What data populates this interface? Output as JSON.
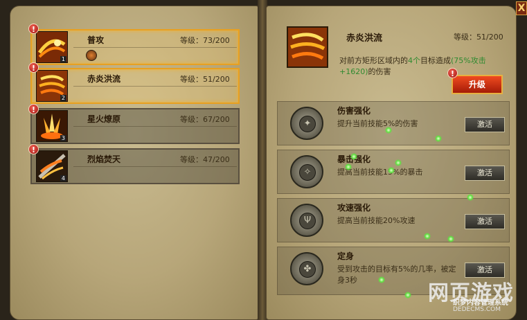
{
  "window": {
    "close_label": "X"
  },
  "skills": [
    {
      "name": "普攻",
      "level": "等级：73/200",
      "slot": "1"
    },
    {
      "name": "赤炎洪流",
      "level": "等级：51/200",
      "slot": "2"
    },
    {
      "name": "星火燎原",
      "level": "等级：67/200",
      "slot": "3"
    },
    {
      "name": "烈焰焚天",
      "level": "等级：47/200",
      "slot": "4"
    }
  ],
  "alert_mark": "!",
  "detail": {
    "title": "赤炎洪流",
    "level": "等级：51/200",
    "desc_a": "对前方矩形区域内的",
    "desc_b": "4个",
    "desc_c": "目标造成",
    "desc_d": "(75%攻击+1620)",
    "desc_e": "的伤害",
    "upgrade_label": "升级"
  },
  "enhancements": [
    {
      "name": "伤害强化",
      "desc": "提升当前技能5%的伤害",
      "button": "激活",
      "icon": "sword-rune-icon"
    },
    {
      "name": "暴击强化",
      "desc": "提高当前技能15%的暴击",
      "button": "激活",
      "icon": "crit-rune-icon"
    },
    {
      "name": "攻速强化",
      "desc": "提高当前技能20%攻速",
      "button": "激活",
      "icon": "trident-rune-icon"
    },
    {
      "name": "定身",
      "desc": "受到攻击的目标有5%的几率，被定身3秒",
      "button": "激活",
      "icon": "root-rune-icon"
    }
  ],
  "watermark": {
    "logo": "网页游戏",
    "line1": "织梦内容管理系统",
    "line2": "DEDECMS.COM"
  },
  "colors": {
    "selected_border": "#e8a020",
    "highlight_green": "#2f8a30",
    "upgrade_red": "#d42c10"
  }
}
